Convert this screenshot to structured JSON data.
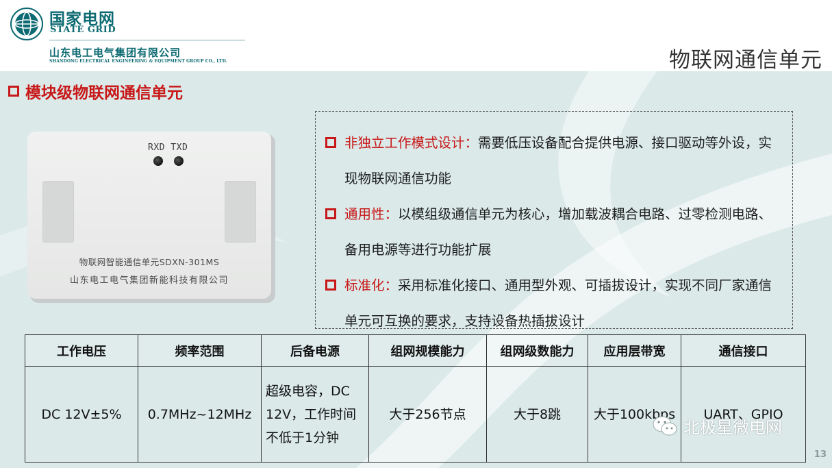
{
  "header": {
    "brand_cn": "国家电网",
    "brand_en": "STATE GRID",
    "company_cn": "山东电工电气集团有限公司",
    "company_en": "SHANDONG ELECTRICAL ENGINEERING & EQUIPMENT GROUP CO., LTD.",
    "slide_title": "物联网通信单元"
  },
  "section": {
    "title": "模块级物联网通信单元"
  },
  "device": {
    "led_label": "RXD TXD",
    "label_line1": "物联网智能通信单元SDXN-301MS",
    "label_line2": "山东电工电气集团新能科技有限公司"
  },
  "features": [
    {
      "keyword": "非独立工作模式设计：",
      "text": "需要低压设备配合提供电源、接口驱动等外设，实现物联网通信功能"
    },
    {
      "keyword": "通用性：",
      "text": "以模组级通信单元为核心，增加载波耦合电路、过零检测电路、备用电源等进行功能扩展"
    },
    {
      "keyword": "标准化：",
      "text": "采用标准化接口、通用型外观、可插拔设计，实现不同厂家通信单元可互换的要求，支持设备热插拔设计"
    }
  ],
  "table": {
    "headers": [
      "工作电压",
      "频率范围",
      "后备电源",
      "组网规模能力",
      "组网级数能力",
      "应用层带宽",
      "通信接口"
    ],
    "row": [
      "DC 12V±5%",
      "0.7MHz~12MHz",
      "超级电容，DC 12V，工作时间不低于1分钟",
      "大于256节点",
      "大于8跳",
      "大于100kbps",
      "UART、GPIO"
    ]
  },
  "watermark": "北极星微电网",
  "page_number": "13",
  "colors": {
    "brand": "#0d6a72",
    "accent_red": "#c81818",
    "background": "#dbe9e9"
  }
}
